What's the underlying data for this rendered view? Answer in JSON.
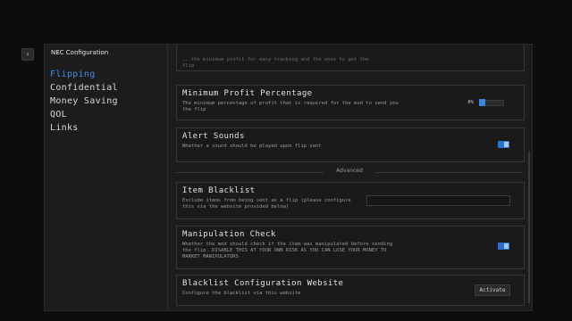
{
  "window": {
    "title": "NEC Configuration",
    "back_icon": "chevron-left-icon",
    "search_icon": "search-icon"
  },
  "sidebar": {
    "items": [
      {
        "label": "Flipping",
        "active": true
      },
      {
        "label": "Confidential",
        "active": false
      },
      {
        "label": "Money Saving",
        "active": false
      },
      {
        "label": "QOL",
        "active": false
      },
      {
        "label": "Links",
        "active": false
      }
    ]
  },
  "content": {
    "partial_top": {
      "desc_line1": "...the minimum profit for easy tracking and the ones to get the",
      "desc_line2": "flip"
    },
    "min_profit": {
      "title": "Minimum Profit Percentage",
      "desc": "The minimum percentage of profit that is required for the mod to send you the flip",
      "value_label": "0%",
      "value": 0
    },
    "alert_sounds": {
      "title": "Alert Sounds",
      "desc": "Whether a sound should be played upon flip sent",
      "enabled": true
    },
    "section_advanced": "Advanced",
    "item_blacklist": {
      "title": "Item Blacklist",
      "desc": "Exclude items from being sent as a flip (please configure this via the website provided below)",
      "value": ""
    },
    "manipulation_check": {
      "title": "Manipulation Check",
      "desc": "Whether the mod should check if the item was manipulated before sending the flip. DISABLE THIS AT YOUR OWN RISK AS YOU CAN LOSE YOUR MONEY TO MARKET MANIPULATORS",
      "enabled": true
    },
    "blacklist_website": {
      "title": "Blacklist Configuration Website",
      "desc": "Configure the blacklist via this website",
      "button_label": "Activate"
    }
  },
  "colors": {
    "accent": "#3f8ee8",
    "toggle_on": "#2a6fd4",
    "background": "#0d0d0d",
    "panel": "#1c1c1c"
  }
}
